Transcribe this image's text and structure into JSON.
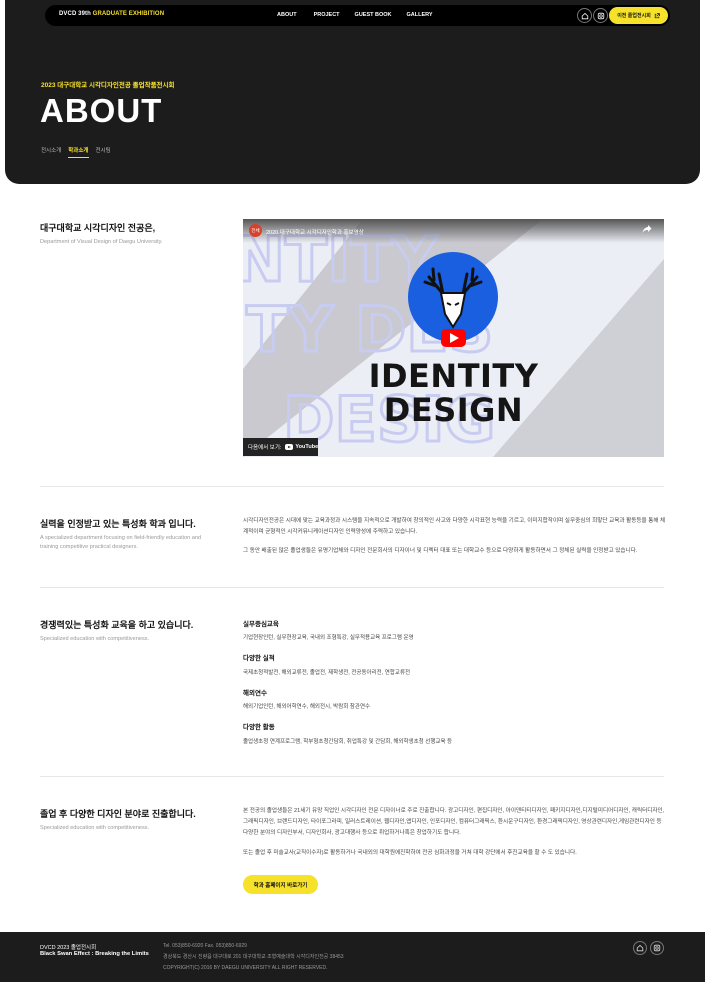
{
  "nav": {
    "brand_prefix": "DVCD 39th ",
    "brand_accent": "GRADUATE EXHIBITION",
    "links": [
      "ABOUT",
      "PROJECT",
      "GUEST BOOK",
      "GALLERY"
    ],
    "home_icon": "home-icon",
    "instagram_icon": "instagram-icon",
    "prev_exhibition_label": "이전 졸업전시회"
  },
  "hero": {
    "subtitle": "2023 대구대학교 시각디자인전공 졸업작품전시회",
    "title": "ABOUT",
    "tabs": [
      "전시소개",
      "학과소개",
      "전시팀"
    ],
    "active_tab": "학과소개"
  },
  "intro": {
    "title": "대구대학교 시각디자인 전공은,",
    "desc": "Department of Visual Design of Daegu University."
  },
  "video": {
    "channel_badge": "전체",
    "title": "2020 대구대학교 시각디자인학과 홍보영상",
    "headline_1": "IDENTITY",
    "headline_2": "DESIGN",
    "watch_label": "다음에서 보기:",
    "youtube_label": "YouTube"
  },
  "section2": {
    "title": "실력을 인정받고 있는 특성화 학과 입니다.",
    "desc": "A specialized department focusing on field-friendly education and training competitive practical designers.",
    "para1": "시각디자인전공은 시대에 맞는 교육과정과 시스템을 지속적으로 개발하여 창의적인 사고와 다양한 시각표현 능력을 기르고, 이미지합작이며 실무중심의 희맣단 교육과 활동등을 통해 체계적이며 균형적인 시각커뮤니케이션디자인 인력양성에 주력하고 있습니다.",
    "para2": "그 동안 배출된 많은 졸업생들은 유명기업체와 디자인 전문회사의 디자이너 및 디렉터 대표 또는 대학교수 등으로 다양하게 활동하면서 그 정체된 실력을 인정받고 있습니다."
  },
  "section3": {
    "title": "경쟁력있는 특성화 교육을 하고 있습니다.",
    "desc": "Specialized education with competitiveness.",
    "items": [
      {
        "head": "실무중심교육",
        "text": "기업현장인턴, 실무현장교육, 국내외 조형특강, 실무적용교육 프로그램 운영"
      },
      {
        "head": "다양한 실적",
        "text": "국제초청적발전, 해외교류전, 졸업전, 제학생전, 전공동아리전, 연합교류전"
      },
      {
        "head": "해외연수",
        "text": "해외기업인턴, 해외어학연수, 해외전시, 박람회 참관연수"
      },
      {
        "head": "다양한 활동",
        "text": "졸업생초청 연계프로그램, 학부형초청간담회, 취업특강 및 간담회, 해외학생초청 선행교육 등"
      }
    ]
  },
  "section4": {
    "title": "졸업 후 다양한 디자인 분야로 진출합니다.",
    "desc": "Specialized education with competitiveness.",
    "para1": "본 전공의 졸업생들은 21세기 유망 직업인 시각디자인 전문 디자이너로 주로 진출합니다. 광고디자인, 편집디자인, 아이덴티티디자인, 패키지디자인,디지털미디어디자인, 캐릭터디자인, 그래픽디자인, 브랜드디자인, 타이포그라피, 일러스트레이션, 웹디자인,앱디자인, 인포디자인, 컴퓨터그래픽스, 환시운구디자인, 환경그래픽디자인, 영상관련디자인,게임관련디자인 등 다양한 분야의 디자인부서, 디자인회사, 광고대행사 등으로 취업하거나혹은 창업하기도 합니다.",
    "para2": "또는 졸업 후 미술교사(교직이수자)로 활동하거나 국내외의 대학원에진학하여 전공 심화과정을 거쳐 대학 강단에서 후진교육을 할 수 도 있습니다.",
    "cta_label": "학과 홈페이지 바로가기"
  },
  "footer": {
    "brand1": "DVCD 2023 졸업전시회",
    "brand2": "Black Swan Effect : Breaking the Limits",
    "contact": "Tel. 053)850-6920   Fax. 053)850-6929",
    "address": "경상북도 경산시 진량읍 대구대로 201 대구대학교 조형예술대학 시각디자인전공 38453",
    "copyright": "COPYRIGHT(C) 2016 BY DAEGU UNIVERSITY ALL RIGHT RESERVED."
  },
  "colors": {
    "accent": "#f6e12b",
    "dark": "#1c1c1c",
    "youtube_red": "#ff0000",
    "logo_blue": "#1a5fe0"
  }
}
